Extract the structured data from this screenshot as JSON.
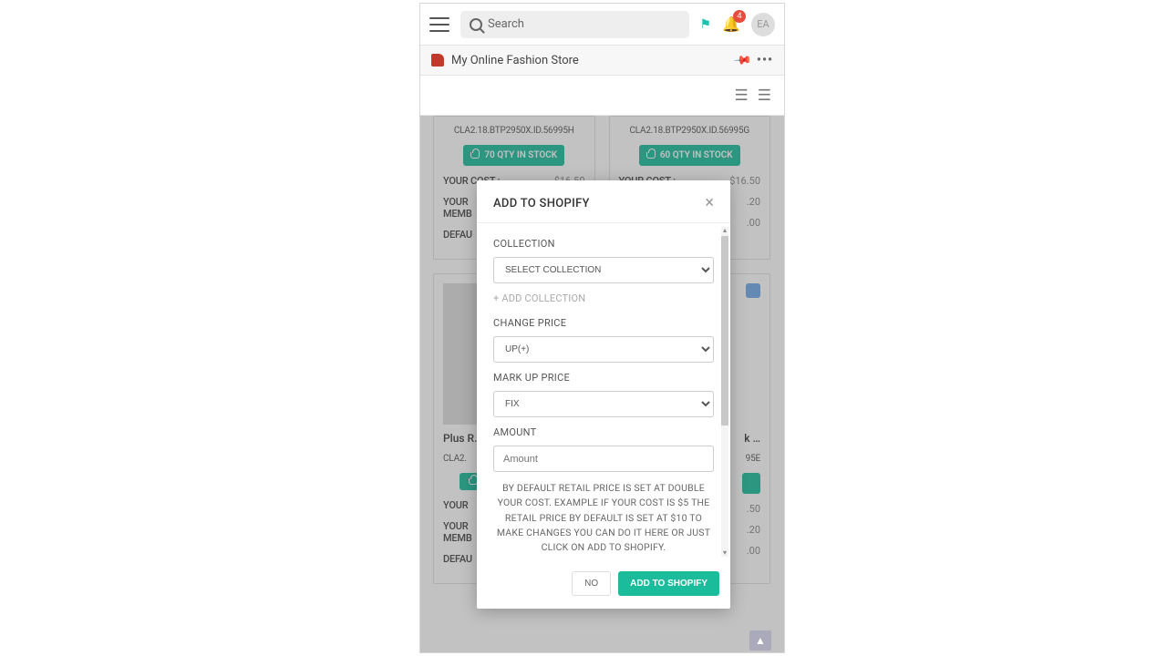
{
  "header": {
    "search_placeholder": "Search",
    "notification_count": "4",
    "avatar_initials": "EA"
  },
  "store_bar": {
    "store_name": "My Online Fashion Store"
  },
  "products": {
    "top_left": {
      "sku": "CLA2.18.BTP2950X.ID.56995H",
      "stock": "70 QTY IN STOCK",
      "cost_label": "YOUR COST :",
      "cost_value": "$16.50",
      "member_label": "YOUR\nMEMB",
      "default_label": "DEFAU"
    },
    "top_right": {
      "sku": "CLA2.18.BTP2950X.ID.56995G",
      "stock": "60 QTY IN STOCK",
      "cost_label": "YOUR COST :",
      "cost_value": "$16.50",
      "row2_value": ".20",
      "row3_value": ".00"
    },
    "bottom_left": {
      "title": "Plus R…",
      "sku_partial": "CLA2.",
      "cost_label": "YOUR",
      "member_label": "YOUR\nMEMB",
      "default_label": "DEFAU"
    },
    "bottom_right": {
      "title_suffix": "k …",
      "sku_suffix": "95E",
      "cost_value": ".50",
      "row2_value": ".20",
      "row3_value": ".00"
    }
  },
  "modal": {
    "title": "ADD TO SHOPIFY",
    "collection_label": "COLLECTION",
    "collection_placeholder": "SELECT COLLECTION",
    "add_collection": "+ ADD COLLECTION",
    "change_price_label": "CHANGE PRICE",
    "change_price_value": "UP(+)",
    "markup_label": "MARK UP PRICE",
    "markup_value": "FIX",
    "amount_label": "AMOUNT",
    "amount_placeholder": "Amount",
    "helper_text": "BY DEFAULT RETAIL PRICE IS SET AT DOUBLE YOUR COST. EXAMPLE IF YOUR COST IS $5 THE RETAIL PRICE BY DEFAULT IS SET AT $10 TO MAKE CHANGES YOU CAN DO IT HERE OR JUST CLICK ON ADD TO SHOPIFY.",
    "no_button": "NO",
    "add_button": "ADD TO SHOPIFY"
  }
}
